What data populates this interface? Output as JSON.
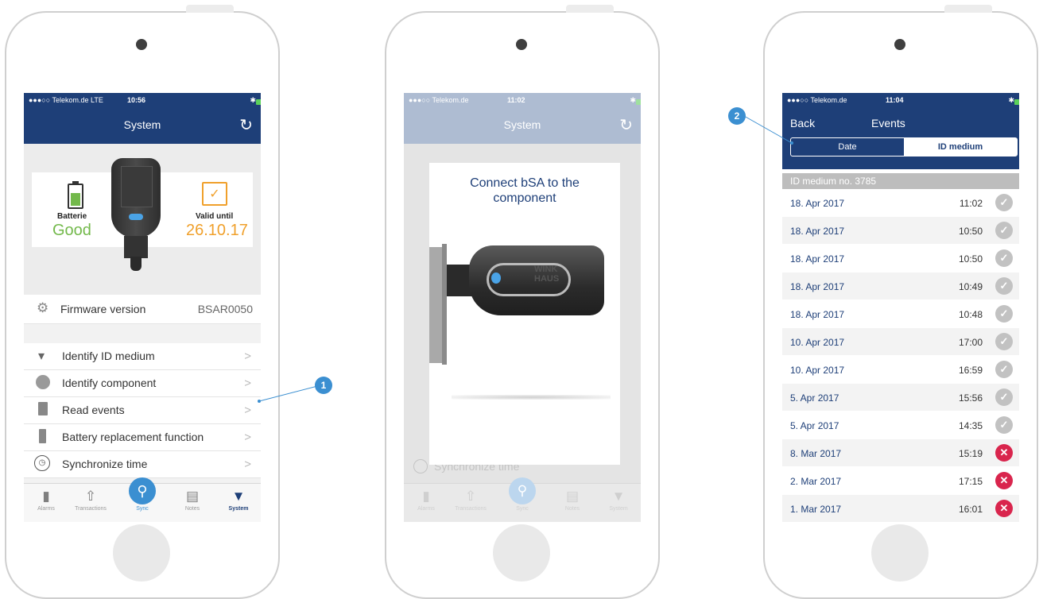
{
  "colors": {
    "nav": "#1e3f78",
    "green": "#73b94b",
    "orange": "#f0a02b",
    "accent": "#3b8fd1",
    "ok": "#c2c2c2",
    "fail": "#d9254d"
  },
  "phone1": {
    "status": {
      "carrier": "●●●○○ Telekom.de  LTE",
      "time": "10:56"
    },
    "title": "System",
    "battery": {
      "label": "Batterie",
      "value": "Good"
    },
    "valid": {
      "label": "Valid until",
      "value": "26.10.17"
    },
    "firmware": {
      "label": "Firmware version",
      "value": "BSAR0050"
    },
    "menu": [
      {
        "label": "Identify ID medium"
      },
      {
        "label": "Identify component"
      },
      {
        "label": "Read events"
      },
      {
        "label": "Battery replacement function"
      },
      {
        "label": "Synchronize time"
      }
    ],
    "tabs": [
      {
        "label": "Alarms"
      },
      {
        "label": "Transactions"
      },
      {
        "label": "Sync"
      },
      {
        "label": "Notes"
      },
      {
        "label": "System"
      }
    ]
  },
  "phone2": {
    "status": {
      "carrier": "●●●○○ Telekom.de",
      "time": "11:02"
    },
    "title": "System",
    "dialog": "Connect bSA to the component",
    "key_brand": "WINK HAUS",
    "bg_item": "Synchronize time",
    "tabs": [
      {
        "label": "Alarms"
      },
      {
        "label": "Transactions"
      },
      {
        "label": "Sync"
      },
      {
        "label": "Notes"
      },
      {
        "label": "System"
      }
    ]
  },
  "phone3": {
    "status": {
      "carrier": "●●●○○ Telekom.de",
      "time": "11:04"
    },
    "back": "Back",
    "title": "Events",
    "segments": [
      "Date",
      "ID medium"
    ],
    "section": "ID medium no. 3785",
    "events": [
      {
        "date": "18. Apr 2017",
        "time": "11:02",
        "ok": true
      },
      {
        "date": "18. Apr 2017",
        "time": "10:50",
        "ok": true
      },
      {
        "date": "18. Apr 2017",
        "time": "10:50",
        "ok": true
      },
      {
        "date": "18. Apr 2017",
        "time": "10:49",
        "ok": true
      },
      {
        "date": "18. Apr 2017",
        "time": "10:48",
        "ok": true
      },
      {
        "date": "10. Apr 2017",
        "time": "17:00",
        "ok": true
      },
      {
        "date": "10. Apr 2017",
        "time": "16:59",
        "ok": true
      },
      {
        "date": "5. Apr 2017",
        "time": "15:56",
        "ok": true
      },
      {
        "date": "5. Apr 2017",
        "time": "14:35",
        "ok": true
      },
      {
        "date": "8. Mar 2017",
        "time": "15:19",
        "ok": false
      },
      {
        "date": "2. Mar 2017",
        "time": "17:15",
        "ok": false
      },
      {
        "date": "1. Mar 2017",
        "time": "16:01",
        "ok": false
      }
    ]
  },
  "callouts": [
    "1",
    "2"
  ]
}
